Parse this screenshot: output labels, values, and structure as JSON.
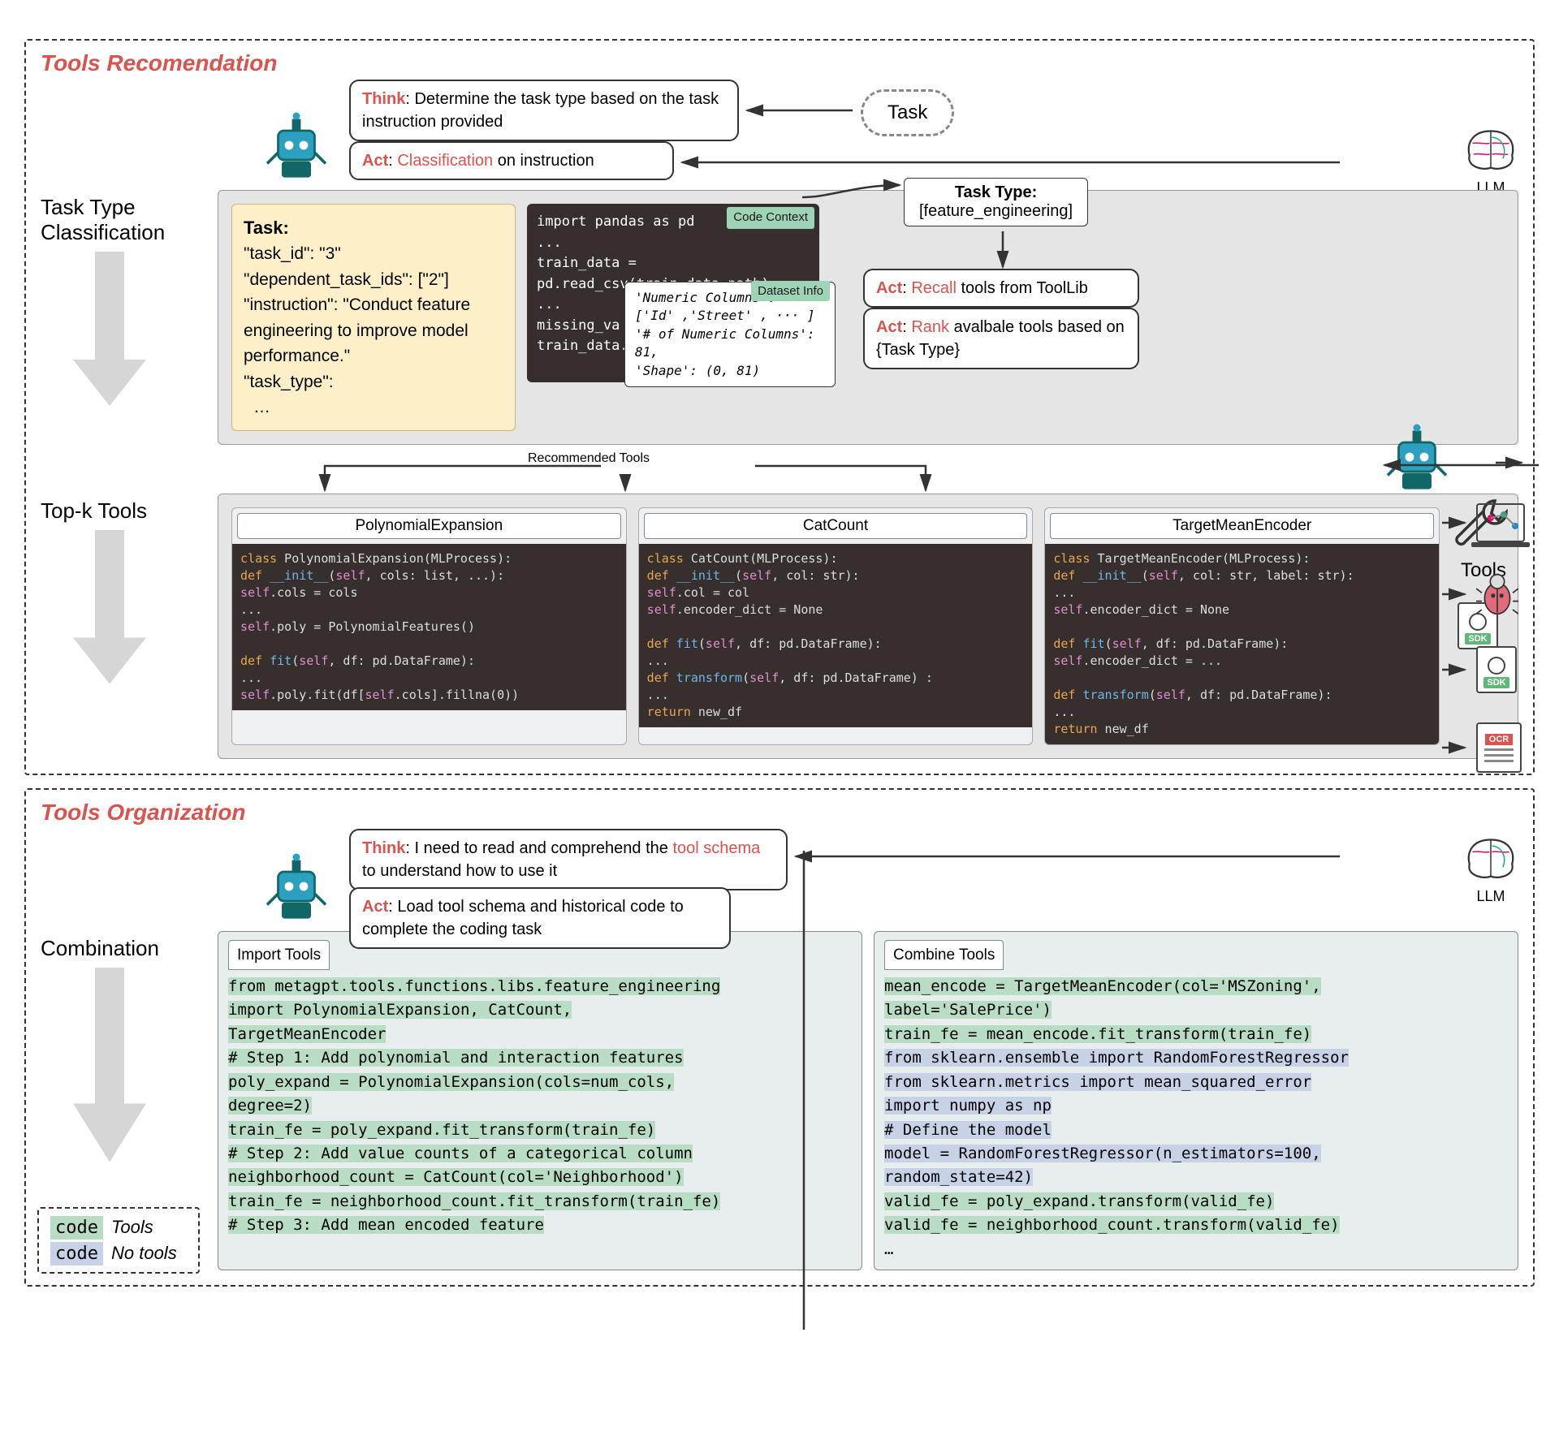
{
  "section1": {
    "title": "Tools Recomendation"
  },
  "section2": {
    "title": "Tools Organization"
  },
  "steps": {
    "s1": "Task Type\nClassification",
    "s2": "Top-k Tools",
    "s3": "Combination"
  },
  "task_cloud": "Task",
  "bubbles": {
    "think1_prefix": "Think",
    "think1": ": Determine the task type based on the task instruction provided",
    "act1_prefix": "Act",
    "act1a": ": ",
    "act1_kw": "Classification",
    "act1b": " on instruction",
    "act_recall_prefix": "Act",
    "act_recall_kw": "Recall",
    "act_recall": "  tools from ToolLib",
    "act_rank_prefix": "Act",
    "act_rank_kw": "Rank",
    "act_rank": " avalbale tools based on {Task Type}",
    "think2_prefix": "Think",
    "think2a": ": I need to read and comprehend the ",
    "think2_kw": "tool schema",
    "think2b": " to understand how to use it",
    "act2_prefix": "Act",
    "act2": ": Load tool schema and historical code to complete the coding task"
  },
  "task_card": {
    "hdr": "Task:",
    "l1": "\"task_id\": \"3\"",
    "l2": "\"dependent_task_ids\": [\"2\"]",
    "l3": "\"instruction\": \"Conduct feature engineering to improve model performance.\"",
    "l4": "\"task_type\":",
    "l5": "…"
  },
  "code_ctx": {
    "tag": "Code Context",
    "l1": "import pandas as pd",
    "l2": "...",
    "l3": "train_data =",
    "l4": "pd.read_csv(train_data_path)",
    "l5": "...",
    "l6": "missing_va",
    "l7": "train_data."
  },
  "dataset_info": {
    "tag": "Dataset Info",
    "l1": "'Numeric Columns':",
    "l2": "['Id' ,'Street' , ··· ]",
    "l3": "'# of Numeric Columns': 81,",
    "l4": "'Shape': (0, 81)"
  },
  "task_type_box": {
    "hdr": "Task Type:",
    "val": "[feature_engineering]"
  },
  "rec_tools_label": "Recommended Tools",
  "tools": {
    "t1": {
      "name": "PolynomialExpansion",
      "code": "<span class='kw-class'>class</span> PolynomialExpansion(MLProcess):\n  <span class='kw-def'>def</span> <span class='fn'>__init__</span>(<span class='kw-self'>self</span>, cols: list, ...):\n    <span class='kw-self'>self</span>.cols = cols\n    ...\n    <span class='kw-self'>self</span>.poly =  PolynomialFeatures()\n\n  <span class='kw-def'>def</span> <span class='fn'>fit</span>(<span class='kw-self'>self</span>, df: pd.DataFrame):\n    ...\n    <span class='kw-self'>self</span>.poly.fit(df[<span class='kw-self'>self</span>.cols].fillna(0))"
    },
    "t2": {
      "name": "CatCount",
      "code": "<span class='kw-class'>class</span> CatCount(MLProcess):\n  <span class='kw-def'>def</span> <span class='fn'>__init__</span>(<span class='kw-self'>self</span>, col: str):\n    <span class='kw-self'>self</span>.col = col\n    <span class='kw-self'>self</span>.encoder_dict = None\n\n  <span class='kw-def'>def</span> <span class='fn'>fit</span>(<span class='kw-self'>self</span>, df: pd.DataFrame):\n    ...\n  <span class='kw-def'>def</span> <span class='fn'>transform</span>(<span class='kw-self'>self</span>, df: pd.DataFrame) :\n    ...\n    <span class='kw-ret'>return</span> new_df"
    },
    "t3": {
      "name": "TargetMeanEncoder",
      "code": "<span class='kw-class'>class</span> TargetMeanEncoder(MLProcess):\n  <span class='kw-def'>def</span> <span class='fn'>__init__</span>(<span class='kw-self'>self</span>, col: str, label: str):\n    ...\n    <span class='kw-self'>self</span>.encoder_dict = None\n\n  <span class='kw-def'>def</span> <span class='fn'>fit</span>(<span class='kw-self'>self</span>, df: pd.DataFrame):\n    <span class='kw-self'>self</span>.encoder_dict = ...\n\n  <span class='kw-def'>def</span> <span class='fn'>transform</span>(<span class='kw-self'>self</span>, df: pd.DataFrame):\n    ...\n    <span class='kw-ret'>return</span> new_df"
    }
  },
  "out_left": {
    "tab": "Import Tools",
    "lines": [
      {
        "c": "g",
        "t": "from metagpt.tools.functions.libs.feature_engineering"
      },
      {
        "c": "g",
        "t": "import PolynomialExpansion, CatCount,"
      },
      {
        "c": "g",
        "t": "TargetMeanEncoder"
      },
      {
        "c": "",
        "t": " "
      },
      {
        "c": "g",
        "t": "# Step 1: Add polynomial and interaction features"
      },
      {
        "c": "g",
        "t": "poly_expand = PolynomialExpansion(cols=num_cols,"
      },
      {
        "c": "g",
        "t": "degree=2)"
      },
      {
        "c": "g",
        "t": "train_fe = poly_expand.fit_transform(train_fe)"
      },
      {
        "c": "",
        "t": " "
      },
      {
        "c": "g",
        "t": "# Step 2: Add value counts of a categorical column"
      },
      {
        "c": "g",
        "t": "neighborhood_count = CatCount(col='Neighborhood')"
      },
      {
        "c": "g",
        "t": "train_fe = neighborhood_count.fit_transform(train_fe)"
      },
      {
        "c": "",
        "t": " "
      },
      {
        "c": "g",
        "t": "# Step 3: Add mean encoded feature"
      }
    ]
  },
  "out_right": {
    "tab": "Combine Tools",
    "lines": [
      {
        "c": "g",
        "t": "mean_encode = TargetMeanEncoder(col='MSZoning',"
      },
      {
        "c": "g",
        "t": "label='SalePrice')"
      },
      {
        "c": "g",
        "t": "train_fe = mean_encode.fit_transform(train_fe)"
      },
      {
        "c": "",
        "t": " "
      },
      {
        "c": "b",
        "t": "from sklearn.ensemble import RandomForestRegressor"
      },
      {
        "c": "b",
        "t": "from sklearn.metrics import mean_squared_error"
      },
      {
        "c": "b",
        "t": "import numpy as np"
      },
      {
        "c": "b",
        "t": "# Define the model"
      },
      {
        "c": "b",
        "t": "model = RandomForestRegressor(n_estimators=100,"
      },
      {
        "c": "b",
        "t": "random_state=42)"
      },
      {
        "c": "",
        "t": " "
      },
      {
        "c": "g",
        "t": "valid_fe = poly_expand.transform(valid_fe)"
      },
      {
        "c": "g",
        "t": "valid_fe = neighborhood_count.transform(valid_fe)"
      },
      {
        "c": "",
        "t": "…"
      }
    ]
  },
  "legend": {
    "code": "code",
    "tools": "Tools",
    "notools": "No tools"
  },
  "llm": "LLM",
  "tools_label": "Tools",
  "sdk": "SDK",
  "ocr": "OCR"
}
